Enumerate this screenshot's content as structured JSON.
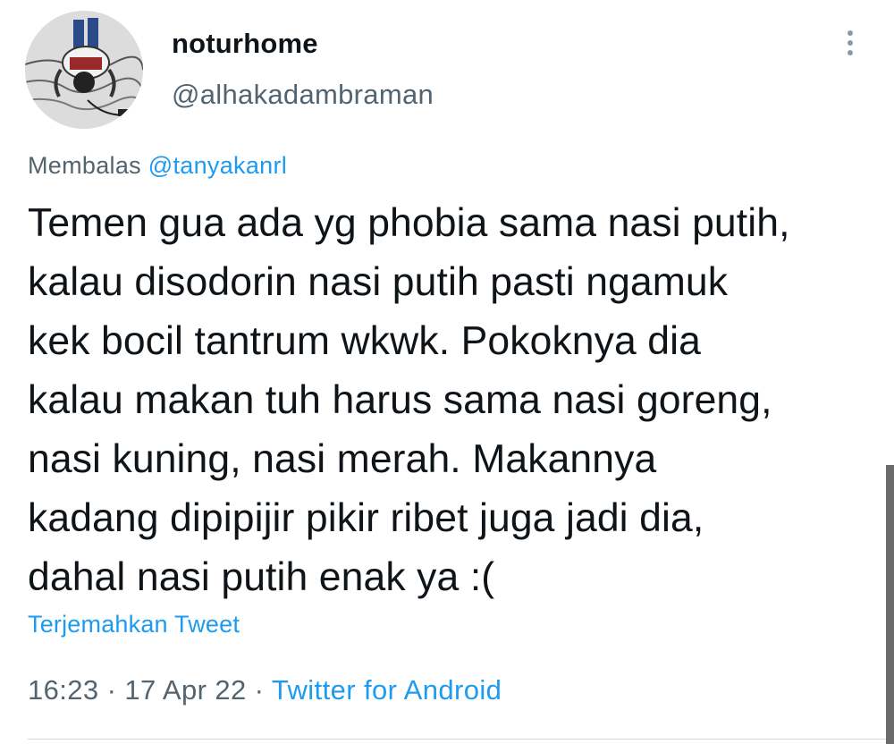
{
  "user": {
    "display_name": "noturhome",
    "handle": "@alhakadambraman",
    "avatar_icon": "avatar-illustration"
  },
  "reply": {
    "prefix": "Membalas",
    "mention": "@tanyakanrl"
  },
  "tweet": {
    "text": "Temen gua ada yg phobia sama nasi putih,\nkalau disodorin nasi putih pasti ngamuk\nkek bocil tantrum wkwk. Pokoknya dia\nkalau makan tuh harus sama nasi goreng,\nnasi kuning, nasi merah. Makannya\nkadang dipipijir pikir ribet juga jadi dia,\ndahal nasi putih enak ya :("
  },
  "translate_label": "Terjemahkan Tweet",
  "meta": {
    "time": "16:23",
    "date": "17 Apr 22",
    "separator": " · ",
    "source": "Twitter for Android"
  },
  "colors": {
    "text": "#0f1419",
    "secondary": "#536471",
    "link": "#1d9bf0"
  }
}
